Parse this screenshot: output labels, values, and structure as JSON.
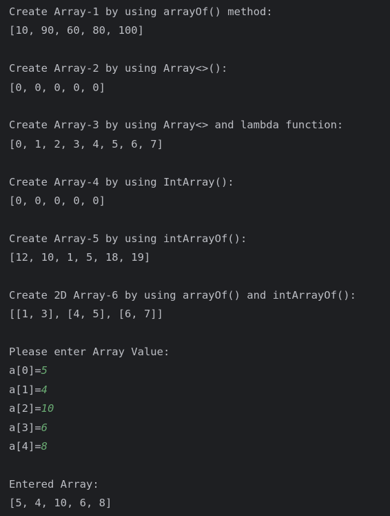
{
  "console": {
    "blocks": [
      {
        "header": "Create Array-1 by using arrayOf() method:",
        "output": "[10, 90, 60, 80, 100]"
      },
      {
        "header": "Create Array-2 by using Array<>():",
        "output": "[0, 0, 0, 0, 0]"
      },
      {
        "header": "Create Array-3 by using Array<> and lambda function:",
        "output": "[0, 1, 2, 3, 4, 5, 6, 7]"
      },
      {
        "header": "Create Array-4 by using IntArray():",
        "output": "[0, 0, 0, 0, 0]"
      },
      {
        "header": "Create Array-5 by using intArrayOf():",
        "output": "[12, 10, 1, 5, 18, 19]"
      },
      {
        "header": "Create 2D Array-6 by using arrayOf() and intArrayOf():",
        "output": "[[1, 3], [4, 5], [6, 7]]"
      }
    ],
    "prompt": "Please enter Array Value:",
    "inputs": [
      {
        "label": "a[0]=",
        "value": "5"
      },
      {
        "label": "a[1]=",
        "value": "4"
      },
      {
        "label": "a[2]=",
        "value": "10"
      },
      {
        "label": "a[3]=",
        "value": "6"
      },
      {
        "label": "a[4]=",
        "value": "8"
      }
    ],
    "result_header": "Entered Array:",
    "result_output": "[5, 4, 10, 6, 8]"
  },
  "colors": {
    "background": "#1e1f22",
    "text": "#bcbec4",
    "user_input": "#6aab73"
  }
}
